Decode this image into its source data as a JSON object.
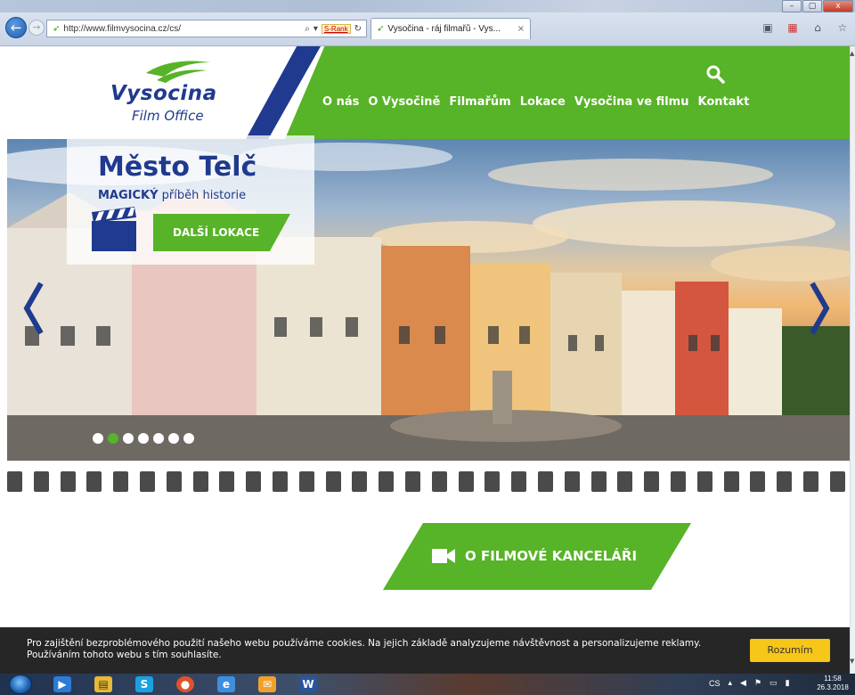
{
  "browser": {
    "url": "http://www.filmvysocina.cz/cs/",
    "tab_title": "Vysočina - ráj filmařů - Vys...",
    "tab_close": "×",
    "srank_label": "S-Rank",
    "window_buttons": {
      "minimize": "–",
      "maximize": "▢",
      "close": "x"
    }
  },
  "site": {
    "logo_main": "Vysocina",
    "logo_sub": "Film Office",
    "nav": [
      "O nás",
      "O Vysočině",
      "Filmařům",
      "Lokace",
      "Vysočina ve filmu",
      "Kontakt"
    ],
    "brand_colors": {
      "green": "#57b327",
      "blue": "#1f3a8e"
    }
  },
  "hero": {
    "title": "Město Telč",
    "subtitle_bold": "MAGICKÝ",
    "subtitle_rest": " příběh historie",
    "button": "DALŠÍ LOKACE",
    "slides_count": 7,
    "active_slide": 2
  },
  "main": {
    "office_button": "O FILMOVÉ KANCELÁŘI"
  },
  "cookie": {
    "text": "Pro zajištění bezproblémového použití našeho webu používáme cookies. Na jejich základě analyzujeme návštěvnost a personalizujeme reklamy. Používáním tohoto webu s tím souhlasíte.",
    "button": "Rozumím"
  },
  "taskbar": {
    "items": [
      "windows-explorer-icon",
      "outlook-icon",
      "skype-icon",
      "chrome-icon",
      "internet-explorer-icon",
      "mail-icon",
      "word-icon"
    ],
    "language": "CS",
    "time": "11:58",
    "date": "26.3.2018"
  }
}
